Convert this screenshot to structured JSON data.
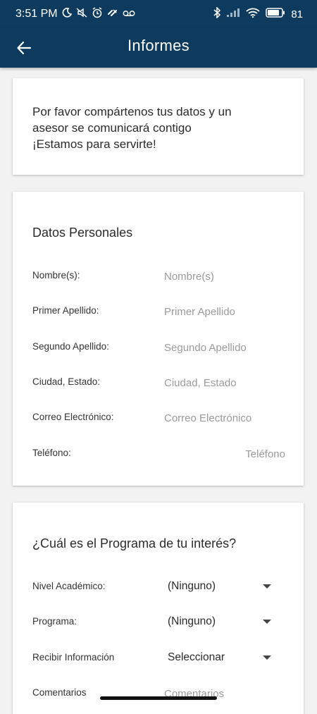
{
  "status_bar": {
    "time": "3:51 PM",
    "left_icons": [
      "moon-icon",
      "mute-icon",
      "alarm-icon",
      "linked-icon",
      "voicemail-icon"
    ],
    "right_icons": [
      "bluetooth-icon",
      "signal-icon",
      "wifi-icon",
      "battery-icon"
    ],
    "battery": "81"
  },
  "app_bar": {
    "title": "Informes",
    "back_icon": "arrow-left-icon"
  },
  "intro": {
    "line1": "Por favor compártenos tus datos y un",
    "line2": "asesor se comunicará contigo",
    "line3": "¡Estamos para servirte!"
  },
  "personal": {
    "heading": "Datos Personales",
    "fields": [
      {
        "label": "Nombre(s):",
        "placeholder": "Nombre(s)",
        "value": ""
      },
      {
        "label": "Primer Apellido:",
        "placeholder": "Primer Apellido",
        "value": ""
      },
      {
        "label": "Segundo Apellido:",
        "placeholder": "Segundo Apellido",
        "value": ""
      },
      {
        "label": "Ciudad, Estado:",
        "placeholder": "Ciudad, Estado",
        "value": ""
      },
      {
        "label": "Correo Electrónico:",
        "placeholder": "Correo Electrónico",
        "value": ""
      },
      {
        "label": "Teléfono:",
        "placeholder": "Teléfono",
        "value": ""
      }
    ]
  },
  "program": {
    "heading": "¿Cuál es el Programa de tu interés?",
    "selects": [
      {
        "label": "Nivel Académico:",
        "value": "(Ninguno)"
      },
      {
        "label": "Programa:",
        "value": "(Ninguno)"
      },
      {
        "label": "Recibir Información",
        "value": "Seleccionar"
      }
    ],
    "comments": {
      "label": "Comentarios",
      "placeholder": "Comentarios"
    }
  },
  "colors": {
    "primary": "#0e3a5e",
    "background": "#f2f2f2",
    "card": "#ffffff",
    "placeholder": "#9a9a9a"
  }
}
